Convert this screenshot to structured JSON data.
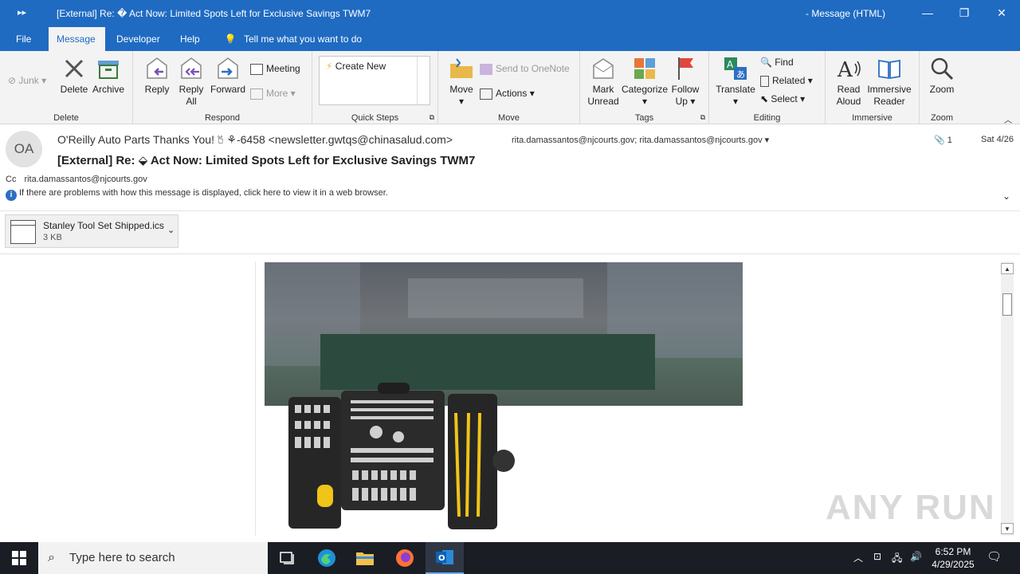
{
  "window": {
    "title": "[External] Re: � Act Now: Limited Spots Left for Exclusive Savings    TWM7",
    "message_type": "-  Message (HTML)"
  },
  "menu": {
    "tabs": [
      "File",
      "Message",
      "Developer",
      "Help"
    ],
    "tell_me": "Tell me what you want to do"
  },
  "ribbon": {
    "delete_group": {
      "label": "Delete",
      "junk": "Junk",
      "delete": "Delete",
      "archive": "Archive"
    },
    "respond_group": {
      "label": "Respond",
      "reply": "Reply",
      "reply_all_1": "Reply",
      "reply_all_2": "All",
      "forward": "Forward",
      "meeting": "Meeting",
      "more": "More"
    },
    "quick_steps_group": {
      "label": "Quick Steps",
      "create_new": "Create New"
    },
    "move_group": {
      "label": "Move",
      "move": "Move",
      "send_onenote": "Send to OneNote",
      "actions": "Actions"
    },
    "tags_group": {
      "label": "Tags",
      "mark_unread_1": "Mark",
      "mark_unread_2": "Unread",
      "categorize": "Categorize",
      "follow_up_1": "Follow",
      "follow_up_2": "Up"
    },
    "editing_group": {
      "label": "Editing",
      "translate": "Translate",
      "find": "Find",
      "related": "Related",
      "select": "Select"
    },
    "immersive_group": {
      "label": "Immersive",
      "read_aloud_1": "Read",
      "read_aloud_2": "Aloud",
      "reader_1": "Immersive",
      "reader_2": "Reader"
    },
    "zoom_group": {
      "label": "Zoom",
      "zoom": "Zoom"
    }
  },
  "header": {
    "avatar_initials": "OA",
    "from": "O'Reilly Auto Parts Thanks You! 🖔 ⚘-6458 <newsletter.gwtqs@chinasalud.com>",
    "to": "rita.damassantos@njcourts.gov; rita.damassantos@njcourts.gov",
    "attachment_count": "1",
    "date": "Sat 4/26",
    "subject": "[External] Re: ⬙ Act Now: Limited Spots Left for Exclusive Savings    TWM7",
    "cc_label": "Cc",
    "cc": "rita.damassantos@njcourts.gov",
    "info_bar": "If there are problems with how this message is displayed, click here to view it in a web browser."
  },
  "attachment": {
    "name": "Stanley Tool Set Shipped.ics",
    "size": "3 KB"
  },
  "watermark": "ANY RUN",
  "taskbar": {
    "search_placeholder": "Type here to search",
    "time": "6:52 PM",
    "date": "4/29/2025"
  },
  "colors": {
    "accent": "#1f6bc2",
    "ribbon_bg": "#f3f3f3",
    "taskbar_bg": "#1a1d24"
  }
}
